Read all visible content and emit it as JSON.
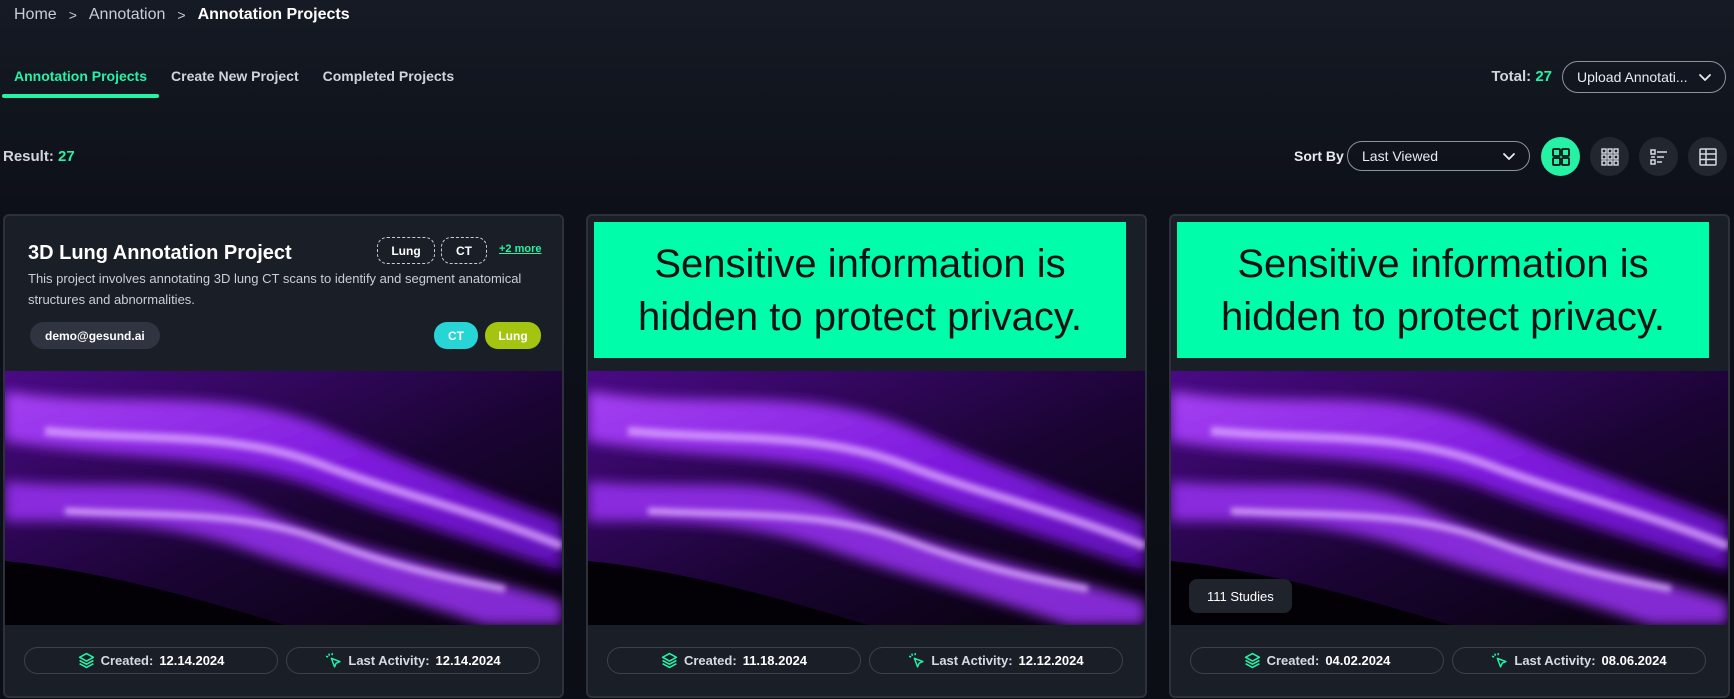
{
  "breadcrumb": {
    "items": [
      "Home",
      "Annotation"
    ],
    "current": "Annotation Projects",
    "separator": ">"
  },
  "tabs": [
    "Annotation Projects",
    "Create New Project",
    "Completed Projects"
  ],
  "total": {
    "label": "Total:",
    "value": "27"
  },
  "upload_button": {
    "label": "Upload Annotati..."
  },
  "result": {
    "label": "Result:",
    "value": "27"
  },
  "sort": {
    "label": "Sort By",
    "selected": "Last Viewed"
  },
  "views": [
    "grid-large-icon",
    "grid-small-icon",
    "list-icon",
    "table-icon"
  ],
  "colors": {
    "accent": "#25f2a5",
    "ct_tag": "#27d4d6",
    "lung_tag": "#a4c410",
    "privacy": "#00fda9"
  },
  "privacy_text": "Sensitive information is hidden to protect privacy.",
  "cards": [
    {
      "title": "3D Lung Annotation Project",
      "description": "This project involves annotating 3D lung CT scans to identify and segment anatomical structures and abnormalities.",
      "dashed_tags": [
        "Lung",
        "CT"
      ],
      "more": "+2 more",
      "owner": "demo@gesund.ai",
      "tags": [
        "CT",
        "Lung"
      ],
      "created_label": "Created:",
      "created": "12.14.2024",
      "activity_label": "Last Activity:",
      "activity": "12.14.2024"
    },
    {
      "created_label": "Created:",
      "created": "11.18.2024",
      "activity_label": "Last Activity:",
      "activity": "12.12.2024"
    },
    {
      "studies": "111 Studies",
      "created_label": "Created:",
      "created": "04.02.2024",
      "activity_label": "Last Activity:",
      "activity": "08.06.2024"
    }
  ]
}
